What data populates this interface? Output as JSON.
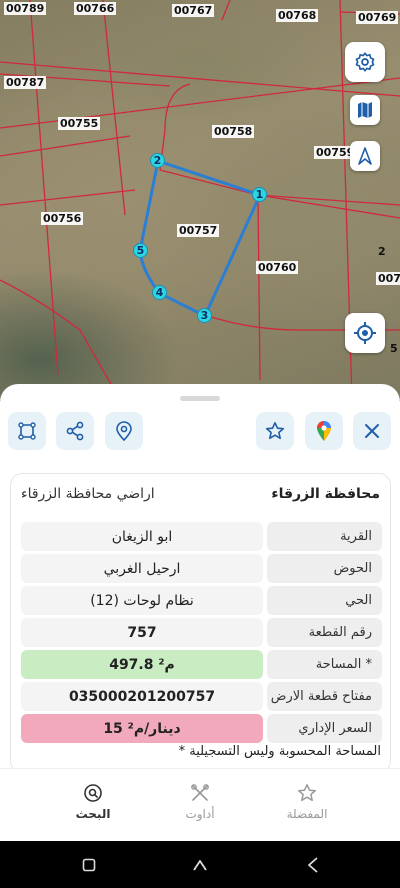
{
  "status_bar": {
    "time": "00789",
    "right_label": "00769"
  },
  "map": {
    "parcel_labels": [
      {
        "id": "00766",
        "text": "00766"
      },
      {
        "id": "00767",
        "text": "00767"
      },
      {
        "id": "00768",
        "text": "00768"
      },
      {
        "id": "00787",
        "text": "00787"
      },
      {
        "id": "00755",
        "text": "00755"
      },
      {
        "id": "00758",
        "text": "00758"
      },
      {
        "id": "00759",
        "text": "00759"
      },
      {
        "id": "00756",
        "text": "00756"
      },
      {
        "id": "00757",
        "text": "00757"
      },
      {
        "id": "00760",
        "text": "00760"
      },
      {
        "id": "0078",
        "text": "0078"
      },
      {
        "id": "2",
        "text": "2"
      },
      {
        "id": "5",
        "text": "5"
      }
    ],
    "vertices": [
      "1",
      "2",
      "3",
      "4",
      "5"
    ],
    "boundary_color": "#2a7fd4",
    "lot_line_color": "#d0293b",
    "vertex_color": "#2bd6e0",
    "buttons": [
      "settings-icon",
      "map-icon",
      "compass-icon",
      "locate-icon"
    ]
  },
  "actions": {
    "left": [
      "polygon-icon",
      "share-icon",
      "location-pin-icon"
    ],
    "right": [
      "star-icon",
      "google-maps-icon",
      "close-icon"
    ]
  },
  "card": {
    "title": "محافظة الزرقاء",
    "subtitle": "اراضي محافظة الزرقاء",
    "rows": [
      {
        "key": "القرية",
        "value": "ابو الزيغان"
      },
      {
        "key": "الحوض",
        "value": "ارحيل الغربي"
      },
      {
        "key": "الحي",
        "value": "(12) نظام لوحات"
      },
      {
        "key": "رقم القطعة",
        "value": "757"
      },
      {
        "key": "المساحة *",
        "value": "497.8 م²"
      },
      {
        "key": "مفتاح قطعة الارض",
        "value": "035000201200757"
      },
      {
        "key": "السعر الإداري",
        "value": "15 دينار/م²"
      }
    ],
    "footnote": "* المساحة المحسوبة وليس التسجيلية"
  },
  "bottom_nav": {
    "favorites": "المفضلة",
    "tools": "أداوت",
    "search": "البحث"
  },
  "colors": {
    "accent": "#2a7fd4",
    "area_bg": "#c9ecc3",
    "price_bg": "#f2a9bb",
    "action_bg": "#e6f1f8"
  }
}
